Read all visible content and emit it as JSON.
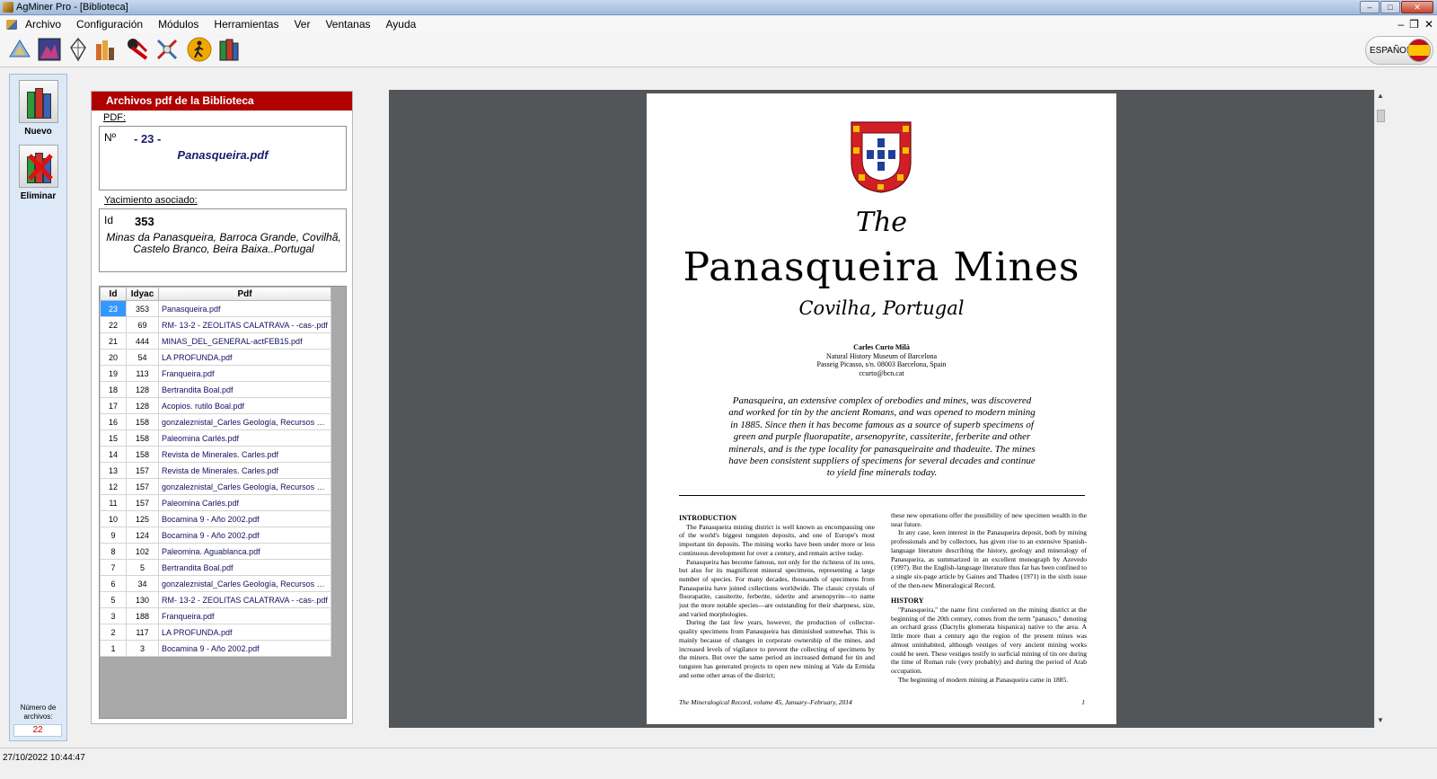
{
  "window": {
    "title": "AgMiner Pro - [Biblioteca]"
  },
  "menu": [
    "Archivo",
    "Configuración",
    "Módulos",
    "Herramientas",
    "Ver",
    "Ventanas",
    "Ayuda"
  ],
  "toolbar": {
    "icons": [
      "map-compass-icon",
      "mountain-chart-icon",
      "crystal-icon",
      "bar-chart-books-icon",
      "geology-hammer-icon",
      "tools-icon",
      "hiker-icon",
      "library-books-icon"
    ],
    "language": "ESPAÑOL"
  },
  "actions": {
    "new_label": "Nuevo",
    "delete_label": "Eliminar"
  },
  "file_count": {
    "label": "Número de archivos:",
    "value": "22"
  },
  "library": {
    "header": "Archivos pdf de la Biblioteca",
    "pdf_label": "PDF:",
    "pdf_no_label": "Nº",
    "pdf_no_value": "- 23 -",
    "pdf_filename": "Panasqueira.pdf",
    "deposit_label": "Yacimiento asociado:",
    "deposit_id_label": "Id",
    "deposit_id_value": "353",
    "deposit_name": "Minas da Panasqueira, Barroca Grande, Covilhã, Castelo Branco, Beira Baixa..Portugal",
    "columns": [
      "Id",
      "Idyac",
      "Pdf"
    ],
    "rows": [
      [
        "23",
        "353",
        "Panasqueira.pdf"
      ],
      [
        "22",
        "69",
        "RM- 13-2 - ZEOLITAS CALATRAVA - -cas-.pdf"
      ],
      [
        "21",
        "444",
        "MINAS_DEL_GENERAL-actFEB15.pdf"
      ],
      [
        "20",
        "54",
        "LA PROFUNDA.pdf"
      ],
      [
        "19",
        "113",
        "Franqueira.pdf"
      ],
      [
        "18",
        "128",
        "Bertrandita Boal.pdf"
      ],
      [
        "17",
        "128",
        "Acopios. rutilo Boal.pdf"
      ],
      [
        "16",
        "158",
        "gonzaleznistal_Carles Geología, Recursos y R..."
      ],
      [
        "15",
        "158",
        "Paleomina Carlés.pdf"
      ],
      [
        "14",
        "158",
        "Revista de Minerales. Carles.pdf"
      ],
      [
        "13",
        "157",
        "Revista de Minerales. Carles.pdf"
      ],
      [
        "12",
        "157",
        "gonzaleznistal_Carles Geología, Recursos y R..."
      ],
      [
        "11",
        "157",
        "Paleomina Carlés.pdf"
      ],
      [
        "10",
        "125",
        "Bocamina 9 - Año 2002.pdf"
      ],
      [
        "9",
        "124",
        "Bocamina 9 - Año 2002.pdf"
      ],
      [
        "8",
        "102",
        "Paleomina. Aguablanca.pdf"
      ],
      [
        "7",
        "5",
        "Bertrandita Boal.pdf"
      ],
      [
        "6",
        "34",
        "gonzaleznistal_Carles Geología, Recursos y R..."
      ],
      [
        "5",
        "130",
        "RM- 13-2 - ZEOLITAS CALATRAVA - -cas-.pdf"
      ],
      [
        "3",
        "188",
        "Franqueira.pdf"
      ],
      [
        "2",
        "117",
        "LA PROFUNDA.pdf"
      ],
      [
        "1",
        "3",
        "Bocamina 9 - Año 2002.pdf"
      ]
    ]
  },
  "document": {
    "the": "The",
    "title": "Panasqueira Mines",
    "subtitle": "Covilha, Portugal",
    "author_name": "Carles Curto Milà",
    "author_affil": "Natural History Museum of Barcelona",
    "author_addr": "Passeig Picasso, s/n. 08003 Barcelona, Spain",
    "author_email": "ccurto@bcn.cat",
    "abstract": "Panasqueira, an extensive complex of orebodies and mines, was discovered and worked for tin by the ancient Romans, and was opened to modern mining in 1885. Since then it has become famous as a source of superb specimens of green and purple fluorapatite, arsenopyrite, cassiterite, ferberite and other minerals, and is the type locality for panasqueiraite and thadeuite. The mines have been consistent suppliers of specimens for several decades and continue to yield fine minerals today.",
    "intro_heading": "INTRODUCTION",
    "intro_p1": "The Panasqueira mining district is well known as encompassing one of the world's biggest tungsten deposits, and one of Europe's most important tin deposits. The mining works have been under more or less continuous development for over a century, and remain active today.",
    "intro_p2": "Panasqueira has become famous, not only for the richness of its ores, but also for its magnificent mineral specimens, representing a large number of species. For many decades, thousands of specimens from Panasqueira have joined collections worldwide. The classic crystals of fluorapatite, cassiterite, ferberite, siderite and arsenopyrite—to name just the more notable species—are outstanding for their sharpness, size, and varied morphologies.",
    "intro_p3": "During the last few years, however, the production of collector-quality specimens from Panasqueira has diminished somewhat. This is mainly because of changes in corporate ownership of the mines, and increased levels of vigilance to prevent the collecting of specimens by the miners. But over the same period an increased demand for tin and tungsten has generated projects to open new mining at Vale da Ermida and some other areas of the district;",
    "col2_p1": "these new operations offer the possibility of new specimen wealth in the near future.",
    "col2_p2": "In any case, keen interest in the Panasqueira deposit, both by mining professionals and by collectors, has given rise to an extensive Spanish-language literature describing the history, geology and mineralogy of Panasqueira, as summarized in an excellent monograph by Azevedo (1997). But the English-language literature thus far has been confined to a single six-page article by Gaines and Thadeu (1971) in the sixth issue of the then-new Mineralogical Record.",
    "history_heading": "HISTORY",
    "history_p1": "\"Panasqueira,\" the name first conferred on the mining district at the beginning of the 20th century, comes from the term \"panasco,\" denoting an orchard grass (Dactylis glomerata hispanica) native to the area. A little more than a century ago the region of the present mines was almost uninhabited, although vestiges of very ancient mining works could be seen. These vestiges testify to surficial mining of tin ore during the time of Roman rule (very probably) and during the period of Arab occupation.",
    "history_p2": "The beginning of modern mining at Panasqueira came in 1885.",
    "footer": "The Mineralogical Record, volume 45, January–February, 2014",
    "page_no": "1"
  },
  "status": {
    "datetime": "27/10/2022 10:44:47"
  }
}
